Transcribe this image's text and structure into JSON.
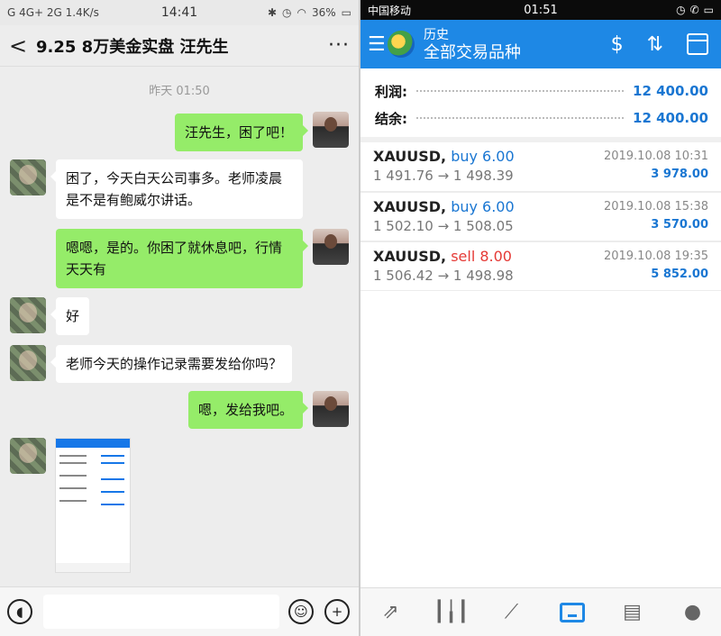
{
  "left": {
    "status": {
      "left": "G 4G+ 2G 1.4K/s",
      "time": "14:41",
      "battery": "36%"
    },
    "header": {
      "back": "<",
      "title": "9.25 8万美金实盘 汪先生",
      "more": "···"
    },
    "timestamp": "昨天 01:50",
    "messages": [
      {
        "from": "me",
        "text": "汪先生，困了吧！"
      },
      {
        "from": "friend",
        "text": "困了，今天白天公司事多。老师凌晨是不是有鲍威尔讲话。"
      },
      {
        "from": "me",
        "text": "嗯嗯，是的。你困了就休息吧，行情天天有"
      },
      {
        "from": "friend",
        "text": "好"
      },
      {
        "from": "friend",
        "text": "老师今天的操作记录需要发给你吗？"
      },
      {
        "from": "me",
        "text": "嗯，发给我吧。"
      }
    ],
    "icons": {
      "voice": "voice-icon",
      "emoji": "emoji-icon",
      "plus": "plus-icon"
    }
  },
  "right": {
    "status": {
      "carrier": "中国移动",
      "time": "01:51"
    },
    "header": {
      "title_small": "历史",
      "title_big": "全部交易品种"
    },
    "summary": [
      {
        "label": "利润:",
        "value": "12 400.00"
      },
      {
        "label": "结余:",
        "value": "12 400.00"
      }
    ],
    "trades": [
      {
        "symbol": "XAUUSD,",
        "side": "buy 6.00",
        "prices": "1 491.76 → 1 498.39",
        "datetime": "2019.10.08 10:31",
        "profit": "3 978.00"
      },
      {
        "symbol": "XAUUSD,",
        "side": "buy 6.00",
        "prices": "1 502.10 → 1 508.05",
        "datetime": "2019.10.08 15:38",
        "profit": "3 570.00"
      },
      {
        "symbol": "XAUUSD,",
        "side": "sell 8.00",
        "prices": "1 506.42 → 1 498.98",
        "datetime": "2019.10.08 19:35",
        "profit": "5 852.00"
      }
    ],
    "colors": {
      "accent": "#1e88e5",
      "buy": "#1976d2",
      "sell": "#e53935"
    }
  }
}
